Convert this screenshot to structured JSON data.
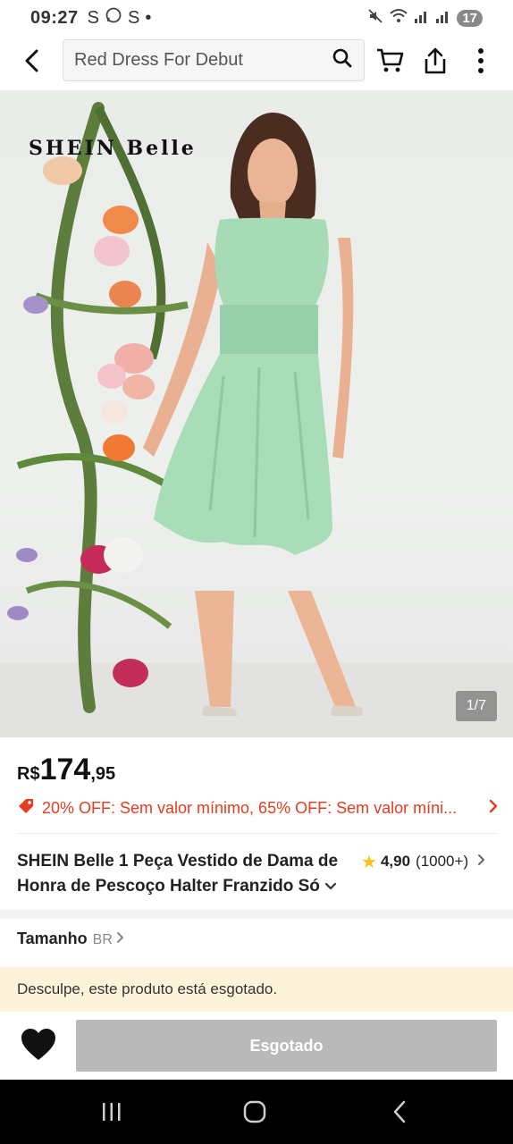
{
  "status_bar": {
    "time": "09:27",
    "left_icons": [
      "S",
      "whatsapp-icon",
      "S",
      "•"
    ],
    "battery": "17"
  },
  "header": {
    "search_text": "Red Dress For Debut"
  },
  "hero": {
    "brand": "SHEIN Belle",
    "image_counter": "1/7"
  },
  "price": {
    "currency": "R$",
    "integer": "174",
    "decimal": ",95"
  },
  "promo": {
    "text": "20% OFF: Sem valor mínimo,  65% OFF: Sem valor míni..."
  },
  "product": {
    "title_line1": "SHEIN Belle 1 Peça Vestido de Dama de",
    "title_line2": "Honra de Pescoço Halter Franzido Só",
    "rating_score": "4,90",
    "rating_count": "(1000+)"
  },
  "size": {
    "label": "Tamanho",
    "unit": "BR"
  },
  "notice": {
    "text": "Desculpe, este produto está esgotado."
  },
  "actions": {
    "sold_out_label": "Esgotado"
  },
  "colors": {
    "promo_red": "#e43d1f",
    "rating_star": "#f7c21a",
    "sold_out_button": "#b9b9b9",
    "notice_bg": "#fdf3da"
  }
}
